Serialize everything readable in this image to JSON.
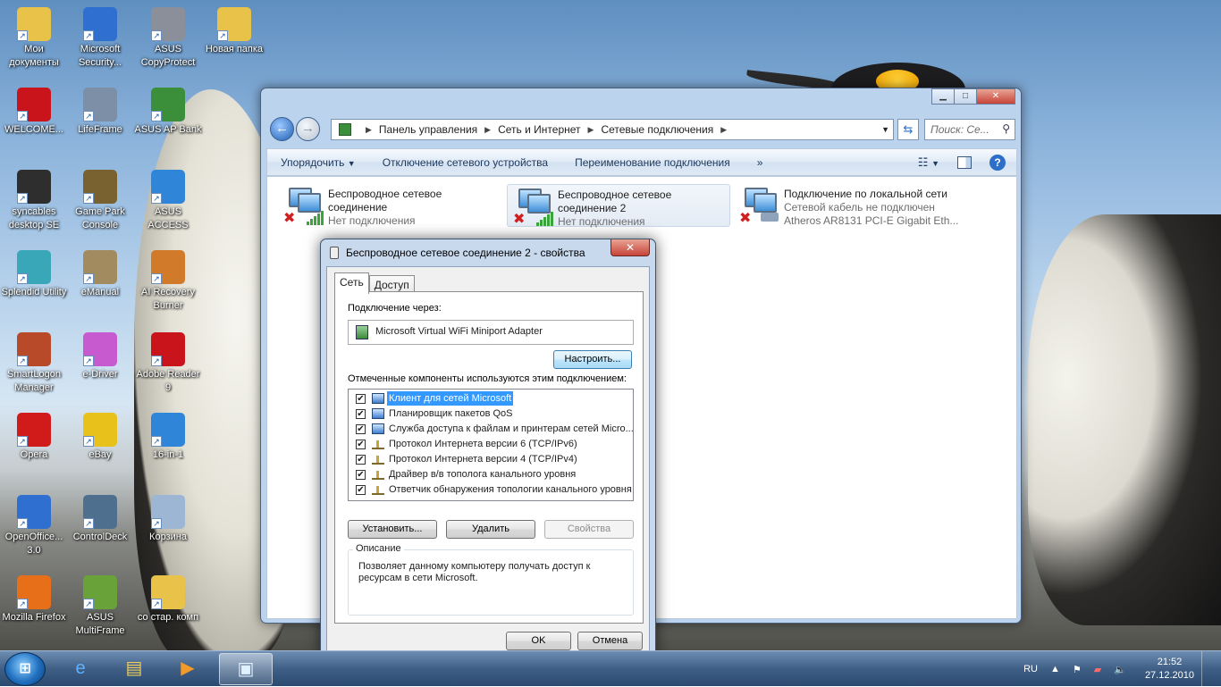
{
  "desktop": {
    "icons": [
      {
        "label": "Мои документы",
        "icon": "folder-icon",
        "color": "#e9c24a"
      },
      {
        "label": "Microsoft Security...",
        "icon": "shield-icon",
        "color": "#2f6fcf"
      },
      {
        "label": "ASUS CopyProtect",
        "icon": "lock-icon",
        "color": "#8a8f99"
      },
      {
        "label": "Новая папка",
        "icon": "folder-icon",
        "color": "#e9c24a"
      },
      {
        "label": "WELCOME...",
        "icon": "flash-icon",
        "color": "#c8141a"
      },
      {
        "label": "LifeFrame",
        "icon": "camera-icon",
        "color": "#7d8fa6"
      },
      {
        "label": "ASUS AP Bank",
        "icon": "app-bank-icon",
        "color": "#3b8f3b"
      },
      {
        "label": "syncables desktop SE",
        "icon": "sync-icon",
        "color": "#2e2e2e"
      },
      {
        "label": "Game Park Console",
        "icon": "game-icon",
        "color": "#7a6130"
      },
      {
        "label": "ASUS ACCESS",
        "icon": "globe-icon",
        "color": "#2f86d8"
      },
      {
        "label": "Splendid Utility",
        "icon": "utility-icon",
        "color": "#3aa7b8"
      },
      {
        "label": "eManual",
        "icon": "manual-icon",
        "color": "#a18b5f"
      },
      {
        "label": "AI Recovery Burner",
        "icon": "recovery-icon",
        "color": "#d07a2a"
      },
      {
        "label": "SmartLogon Manager",
        "icon": "logon-icon",
        "color": "#b84a2a"
      },
      {
        "label": "e-Driver",
        "icon": "disc-icon",
        "color": "#c85ad0"
      },
      {
        "label": "Adobe Reader 9",
        "icon": "pdf-icon",
        "color": "#c8141a"
      },
      {
        "label": "Opera",
        "icon": "opera-icon",
        "color": "#d11a1a"
      },
      {
        "label": "eBay",
        "icon": "ebay-icon",
        "color": "#e8c21a"
      },
      {
        "label": "16-in-1",
        "icon": "card-reader-icon",
        "color": "#2f86d8"
      },
      {
        "label": "OpenOffice... 3.0",
        "icon": "openoffice-icon",
        "color": "#2f6fcf"
      },
      {
        "label": "ControlDeck",
        "icon": "controldeck-icon",
        "color": "#4f6f8f"
      },
      {
        "label": "Корзина",
        "icon": "recycle-bin-icon",
        "color": "#9db6d4"
      },
      {
        "label": "Mozilla Firefox",
        "icon": "firefox-icon",
        "color": "#e86f1a"
      },
      {
        "label": "ASUS MultiFrame",
        "icon": "multiframe-icon",
        "color": "#6aa23a"
      },
      {
        "label": "со стар. комп",
        "icon": "folder-icon",
        "color": "#e9c24a"
      }
    ]
  },
  "explorer": {
    "breadcrumb": [
      "Панель управления",
      "Сеть и Интернет",
      "Сетевые подключения"
    ],
    "search_placeholder": "Поиск: Се...",
    "commands": [
      "Упорядочить",
      "Отключение сетевого устройства",
      "Переименование подключения",
      "»"
    ],
    "connections": [
      {
        "name1": "Беспроводное сетевое",
        "name2": "соединение",
        "status": "Нет подключения",
        "type": "wireless"
      },
      {
        "name1": "Беспроводное сетевое",
        "name2": "соединение 2",
        "status": "Нет подключения",
        "type": "wireless",
        "selected": true
      },
      {
        "name1": "Подключение по локальной сети",
        "name2": "Сетевой кабель не подключен",
        "status": "Atheros AR8131 PCI-E Gigabit Eth...",
        "type": "lan"
      }
    ]
  },
  "dialog": {
    "title": "Беспроводное сетевое соединение 2 - свойства",
    "tabs": [
      "Сеть",
      "Доступ"
    ],
    "connect_via_label": "Подключение через:",
    "adapter": "Microsoft Virtual WiFi Miniport Adapter",
    "configure_button": "Настроить...",
    "components_label": "Отмеченные компоненты используются этим подключением:",
    "components": [
      {
        "label": "Клиент для сетей Microsoft",
        "checked": "✔",
        "icon": "net"
      },
      {
        "label": "Планировщик пакетов QoS",
        "checked": "✔",
        "icon": "net"
      },
      {
        "label": "Служба доступа к файлам и принтерам сетей Micro...",
        "checked": "✔",
        "icon": "net"
      },
      {
        "label": "Протокол Интернета версии 6 (TCP/IPv6)",
        "checked": "✔",
        "icon": "proto"
      },
      {
        "label": "Протокол Интернета версии 4 (TCP/IPv4)",
        "checked": "✔",
        "icon": "proto"
      },
      {
        "label": "Драйвер в/в тополога канального уровня",
        "checked": "✔",
        "icon": "proto"
      },
      {
        "label": "Ответчик обнаружения топологии канального уровня",
        "checked": "✔",
        "icon": "proto"
      }
    ],
    "install_button": "Установить...",
    "remove_button": "Удалить",
    "properties_button": "Свойства",
    "description_legend": "Описание",
    "description": "Позволяет данному компьютеру получать доступ к ресурсам в сети Microsoft.",
    "ok_button": "OK",
    "cancel_button": "Отмена"
  },
  "taskbar": {
    "language": "RU",
    "time": "21:52",
    "date": "27.12.2010",
    "items": [
      "ie-icon",
      "explorer-icon",
      "media-player-icon",
      "network-connections-icon"
    ]
  }
}
